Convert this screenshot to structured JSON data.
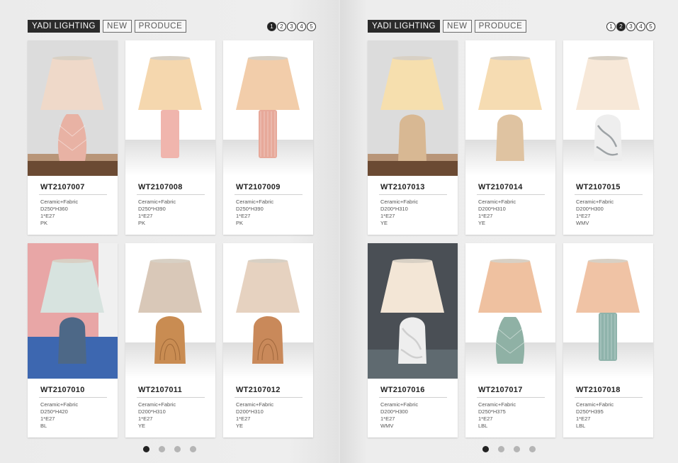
{
  "pages": [
    {
      "brand": "YADI LIGHTING",
      "tag_new": "NEW",
      "tag_produce": "PRODUCE",
      "page_numbers": [
        "1",
        "2",
        "3",
        "4",
        "5"
      ],
      "active_page": 0,
      "dots_active": 0,
      "products": [
        {
          "code": "WT2107007",
          "material": "Ceramic+Fabric",
          "size": "D250*H360",
          "bulb": "1*E27",
          "color": "PK",
          "bg": "room-grey",
          "shade": "#efd9c9",
          "base": "#e8b2a4",
          "shape": "diamond"
        },
        {
          "code": "WT2107008",
          "material": "Ceramic+Fabric",
          "size": "D250*H390",
          "bulb": "1*E27",
          "color": "PK",
          "bg": "studio",
          "shade": "#f5d7ae",
          "base": "#f0b5ad",
          "shape": "cylinder"
        },
        {
          "code": "WT2107009",
          "material": "Ceramic+Fabric",
          "size": "D250*H390",
          "bulb": "1*E27",
          "color": "PK",
          "bg": "studio",
          "shade": "#f2cdaa",
          "base": "#e7a99a",
          "shape": "ribbed"
        },
        {
          "code": "WT2107010",
          "material": "Ceramic+Fabric",
          "size": "D250*H420",
          "bulb": "1*E27",
          "color": "BL",
          "bg": "room-pink",
          "shade": "#d7e3df",
          "base": "#4d6887",
          "shape": "dome"
        },
        {
          "code": "WT2107011",
          "material": "Ceramic+Fabric",
          "size": "D200*H310",
          "bulb": "1*E27",
          "color": "YE",
          "bg": "studio",
          "shade": "#d9c8b8",
          "base": "#c98c52",
          "shape": "wood"
        },
        {
          "code": "WT2107012",
          "material": "Ceramic+Fabric",
          "size": "D200*H310",
          "bulb": "1*E27",
          "color": "YE",
          "bg": "studio",
          "shade": "#e6d2c0",
          "base": "#c9895a",
          "shape": "wood"
        }
      ]
    },
    {
      "brand": "YADI LIGHTING",
      "tag_new": "NEW",
      "tag_produce": "PRODUCE",
      "page_numbers": [
        "1",
        "2",
        "3",
        "4",
        "5"
      ],
      "active_page": 1,
      "dots_active": 0,
      "products": [
        {
          "code": "WT2107013",
          "material": "Ceramic+Fabric",
          "size": "D200*H310",
          "bulb": "1*E27",
          "color": "YE",
          "bg": "room-grey",
          "shade": "#f6dfae",
          "base": "#d8b893",
          "shape": "dome"
        },
        {
          "code": "WT2107014",
          "material": "Ceramic+Fabric",
          "size": "D200*H310",
          "bulb": "1*E27",
          "color": "YE",
          "bg": "studio",
          "shade": "#f6dcb2",
          "base": "#dfc3a1",
          "shape": "dome"
        },
        {
          "code": "WT2107015",
          "material": "Ceramic+Fabric",
          "size": "D200*H300",
          "bulb": "1*E27",
          "color": "WMV",
          "bg": "studio",
          "shade": "#f7e8d8",
          "base": "#9ea3a6",
          "shape": "marble"
        },
        {
          "code": "WT2107016",
          "material": "Ceramic+Fabric",
          "size": "D200*H300",
          "bulb": "1*E27",
          "color": "WMV",
          "bg": "room-dark",
          "shade": "#f3e6d6",
          "base": "#cfcfcf",
          "shape": "marble"
        },
        {
          "code": "WT2107017",
          "material": "Ceramic+Fabric",
          "size": "D250*H375",
          "bulb": "1*E27",
          "color": "LBL",
          "bg": "studio",
          "shade": "#efc1a0",
          "base": "#8fb1a5",
          "shape": "diamond"
        },
        {
          "code": "WT2107018",
          "material": "Ceramic+Fabric",
          "size": "D250*H395",
          "bulb": "1*E27",
          "color": "LBL",
          "bg": "studio",
          "shade": "#f0c3a5",
          "base": "#8fb3ab",
          "shape": "ribbed"
        }
      ]
    }
  ]
}
